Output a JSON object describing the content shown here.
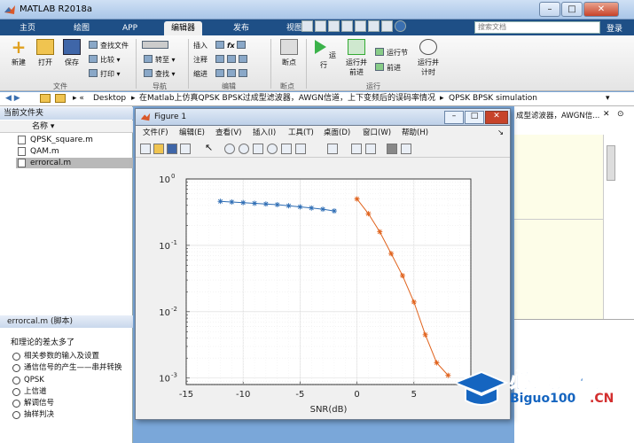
{
  "window": {
    "title": "MATLAB R2018a"
  },
  "tabs": [
    "主页",
    "绘图",
    "APP",
    "编辑器",
    "发布",
    "视图"
  ],
  "active_tab": "编辑器",
  "search": {
    "placeholder": "搜索文档"
  },
  "login": "登录",
  "toolstrip": {
    "file": {
      "new": "新建",
      "open": "打开",
      "save": "保存",
      "find_files": "查找文件",
      "compare": "比较",
      "print": "打印",
      "group": "文件"
    },
    "nav": {
      "goto": "转至",
      "find": "查找",
      "group": "导航"
    },
    "edit": {
      "insert": "插入",
      "comment": "注释",
      "indent": "缩进",
      "fx": "fx",
      "group": "编辑"
    },
    "breakpoints": {
      "label": "断点",
      "group": "断点"
    },
    "run": {
      "run": "运行",
      "run_advance": "运行并\n前进",
      "run_section": "运行节",
      "advance": "前进",
      "run_time": "运行并\n计时",
      "group": "运行"
    }
  },
  "address": {
    "path": [
      "Desktop",
      "在Matlab上仿真QPSK BPSK过成型滤波器，AWGN信道，上下变频后的误码率情况",
      "QPSK BPSK simulation"
    ]
  },
  "current_folder": {
    "title": "当前文件夹",
    "column": "名称 ▾",
    "files": [
      {
        "name": "QPSK_square.m",
        "selected": false
      },
      {
        "name": "QAM.m",
        "selected": false
      },
      {
        "name": "errorcal.m",
        "selected": true
      }
    ]
  },
  "details": {
    "title": "errorcal.m  (脚本)",
    "subtitle": "和理论的差太多了",
    "cells": [
      "相关参数的输入及设置",
      "通信信号的产生——串并转换",
      "QPSK",
      "上信道",
      "解调信号",
      "抽样判决"
    ]
  },
  "editor_tab_text": "成型滤波器，AWGN信...",
  "figure": {
    "title": "Figure 1",
    "menu": [
      "文件(F)",
      "编辑(E)",
      "查看(V)",
      "插入(I)",
      "工具(T)",
      "桌面(D)",
      "窗口(W)",
      "帮助(H)"
    ]
  },
  "chart_data": {
    "type": "line",
    "xlabel": "SNR(dB)",
    "xlim": [
      -15,
      10
    ],
    "xticks": [
      -15,
      -10,
      -5,
      0,
      5
    ],
    "yscale": "log",
    "ylim": [
      0.0008,
      1
    ],
    "yticks": [
      "10^0",
      "10^-1",
      "10^-2",
      "10^-3"
    ],
    "grid": "on",
    "series": [
      {
        "color": "#2e6db4",
        "x": [
          -12,
          -11,
          -10,
          -9,
          -8,
          -7,
          -6,
          -5,
          -4,
          -3,
          -2
        ],
        "y": [
          0.46,
          0.45,
          0.44,
          0.43,
          0.42,
          0.41,
          0.395,
          0.38,
          0.365,
          0.35,
          0.33
        ]
      },
      {
        "color": "#e0621c",
        "x": [
          0,
          1,
          2,
          3,
          4,
          5,
          6,
          7,
          8
        ],
        "y": [
          0.5,
          0.3,
          0.16,
          0.075,
          0.035,
          0.014,
          0.0045,
          0.0017,
          0.0011
        ]
      }
    ]
  },
  "watermark": {
    "cn": "必过源码",
    "en": "Biguo100",
    "dot": ".CN"
  }
}
